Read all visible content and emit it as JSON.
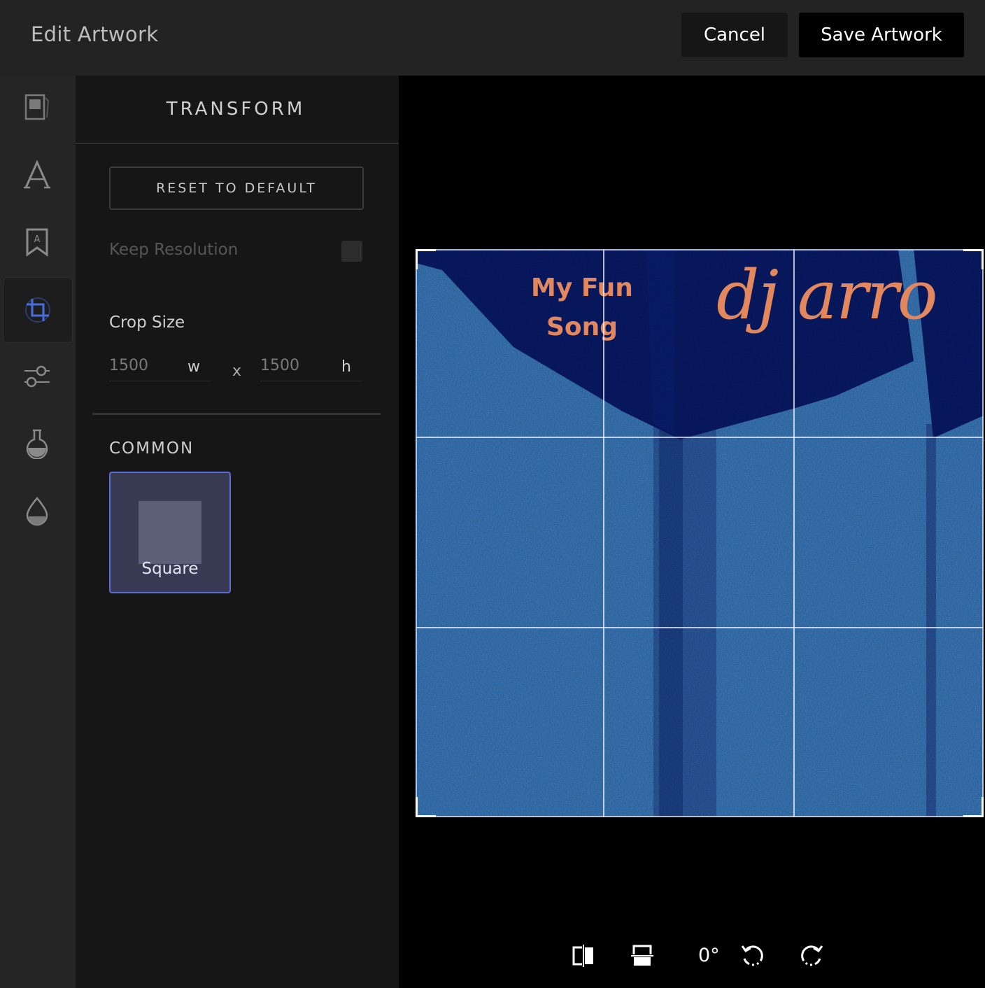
{
  "header": {
    "title": "Edit Artwork",
    "cancel_label": "Cancel",
    "save_label": "Save Artwork"
  },
  "toolbar": {
    "items": [
      {
        "name": "image-icon",
        "active": false
      },
      {
        "name": "text-icon",
        "active": false
      },
      {
        "name": "badge-icon",
        "active": false
      },
      {
        "name": "crop-icon",
        "active": true
      },
      {
        "name": "sliders-icon",
        "active": false
      },
      {
        "name": "flask-icon",
        "active": false
      },
      {
        "name": "drop-icon",
        "active": false
      }
    ]
  },
  "panel": {
    "title": "TRANSFORM",
    "reset_label": "RESET TO DEFAULT",
    "keep_resolution_label": "Keep Resolution",
    "keep_resolution_checked": false,
    "crop_size_label": "Crop Size",
    "width_value": "1500",
    "width_unit": "w",
    "separator": "x",
    "height_value": "1500",
    "height_unit": "h",
    "common_label": "COMMON",
    "presets": [
      {
        "label": "Square",
        "selected": true
      }
    ]
  },
  "artwork": {
    "song_title": "My Fun Song",
    "artist": "dj arro",
    "text_color": "#e3885e",
    "light_blue": "#3d80c6",
    "dark_blue": "#091c6e"
  },
  "canvas_tools": {
    "angle": "0°",
    "buttons": [
      "flip-horizontal-icon",
      "flip-vertical-icon",
      "rotate-left-icon",
      "rotate-right-icon"
    ]
  },
  "colors": {
    "accent": "#5a6dd6",
    "active_icon": "#4a6ee0"
  }
}
